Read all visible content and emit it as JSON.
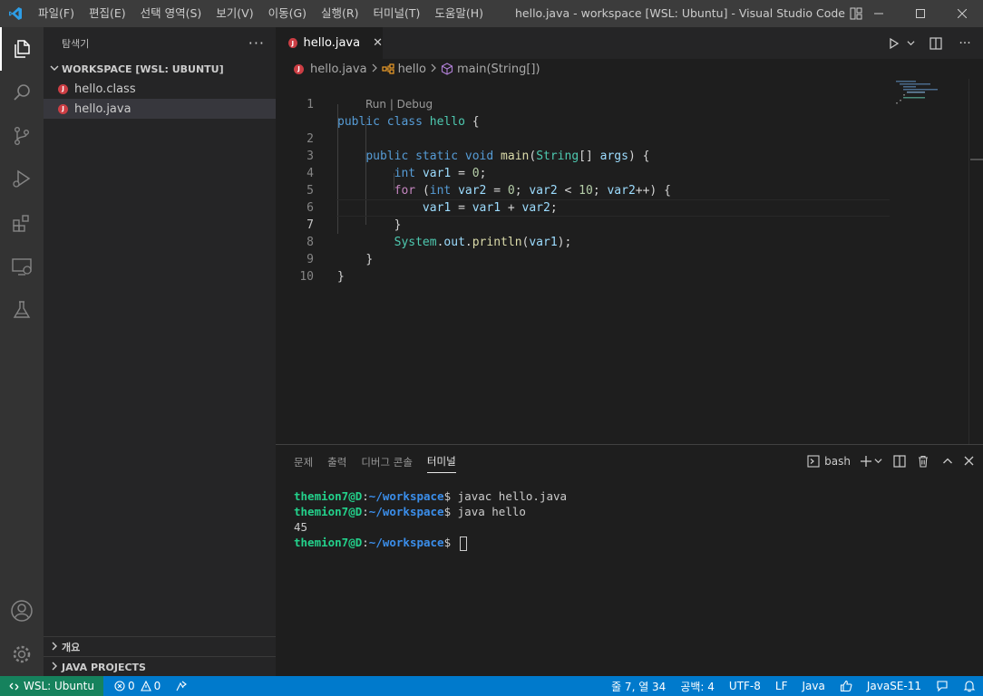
{
  "titlebar": {
    "menu": [
      "파일(F)",
      "편집(E)",
      "선택 영역(S)",
      "보기(V)",
      "이동(G)",
      "실행(R)",
      "터미널(T)",
      "도움말(H)"
    ],
    "window_title": "hello.java - workspace [WSL: Ubuntu] - Visual Studio Code"
  },
  "activity": [
    "explorer-icon",
    "search-icon",
    "source-control-icon",
    "run-debug-icon",
    "extensions-icon",
    "remote-explorer-icon",
    "testing-icon",
    "account-icon",
    "settings-gear-icon"
  ],
  "sidebar": {
    "title": "탐색기",
    "more": "···",
    "workspace": "WORKSPACE [WSL: UBUNTU]",
    "files": [
      {
        "name": "hello.class"
      },
      {
        "name": "hello.java"
      }
    ],
    "outline": "개요",
    "java_projects": "JAVA PROJECTS"
  },
  "editor": {
    "tab_label": "hello.java",
    "tab_close": "✕",
    "breadcrumb": {
      "file": "hello.java",
      "class": "hello",
      "method": "main(String[])"
    },
    "codelens": "Run | Debug",
    "line_numbers": [
      "1",
      "2",
      "3",
      "4",
      "5",
      "6",
      "7",
      "8",
      "9",
      "10"
    ]
  },
  "panel": {
    "tabs": [
      "문제",
      "출력",
      "디버그 콘솔",
      "터미널"
    ],
    "active_tab": "터미널",
    "shell": "bash",
    "terminal": {
      "user": "themion7@D",
      "path": "~/workspace",
      "lines": [
        {
          "cmd": "$ javac hello.java"
        },
        {
          "cmd": "$ java hello"
        },
        {
          "output": "45"
        },
        {
          "cmd": "$ "
        }
      ]
    }
  },
  "statusbar": {
    "remote": "WSL: Ubuntu",
    "errors": "0",
    "warnings": "0",
    "position": "줄 7, 열 34",
    "indent": "공백: 4",
    "encoding": "UTF-8",
    "eol": "LF",
    "language": "Java",
    "jdk": "JavaSE-11"
  },
  "colors": {
    "statusbar": "#007acc",
    "remote": "#16825d",
    "activitybar": "#333333",
    "sidebar": "#252526",
    "editor": "#1e1e1e"
  }
}
